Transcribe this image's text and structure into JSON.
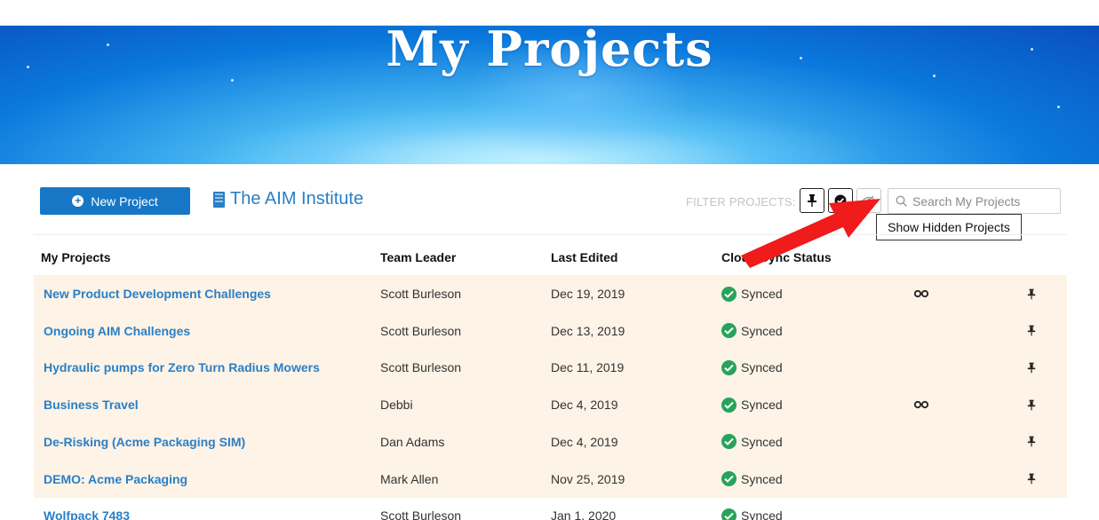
{
  "hero": {
    "title": "My Projects"
  },
  "toolbar": {
    "new_project_label": "New Project",
    "org_name": "The AIM Institute",
    "filter_label": "FILTER PROJECTS:",
    "search_placeholder": "Search My Projects",
    "tooltip": "Show Hidden Projects"
  },
  "table": {
    "headers": {
      "project": "My Projects",
      "leader": "Team Leader",
      "edited": "Last Edited",
      "sync": "Cloud Sync Status"
    },
    "rows": [
      {
        "name": "New Product Development Challenges",
        "leader": "Scott Burleson",
        "edited": "Dec 19, 2019",
        "sync": "Synced",
        "flag": true,
        "pin": true
      },
      {
        "name": "Ongoing AIM Challenges",
        "leader": "Scott Burleson",
        "edited": "Dec 13, 2019",
        "sync": "Synced",
        "flag": false,
        "pin": true
      },
      {
        "name": "Hydraulic pumps for Zero Turn Radius Mowers",
        "leader": "Scott Burleson",
        "edited": "Dec 11, 2019",
        "sync": "Synced",
        "flag": false,
        "pin": true
      },
      {
        "name": "Business Travel",
        "leader": "Debbi",
        "edited": "Dec 4, 2019",
        "sync": "Synced",
        "flag": true,
        "pin": true
      },
      {
        "name": "De-Risking (Acme Packaging SIM)",
        "leader": "Dan Adams",
        "edited": "Dec 4, 2019",
        "sync": "Synced",
        "flag": false,
        "pin": true
      },
      {
        "name": "DEMO: Acme Packaging",
        "leader": "Mark Allen",
        "edited": "Nov 25, 2019",
        "sync": "Synced",
        "flag": false,
        "pin": true
      },
      {
        "name": "Wolfpack 7483",
        "leader": "Scott Burleson",
        "edited": "Jan 1, 2020",
        "sync": "Synced",
        "flag": false,
        "pin": false
      }
    ]
  },
  "icons": {
    "new_project": "plus-circle-icon",
    "org": "building-icon",
    "filter_pinned": "pin-icon",
    "filter_completed": "check-circle-icon",
    "filter_hidden": "eye-slash-icon",
    "search": "search-icon",
    "sync": "check-circle-icon",
    "flag": "binoculars-icon",
    "pin": "pin-icon"
  },
  "colors": {
    "primary": "#1777c6",
    "link": "#2a7fc6",
    "row_highlight": "#fdf3e6",
    "sync_ok": "#27a35a",
    "annotation_arrow": "#f01b1b"
  }
}
